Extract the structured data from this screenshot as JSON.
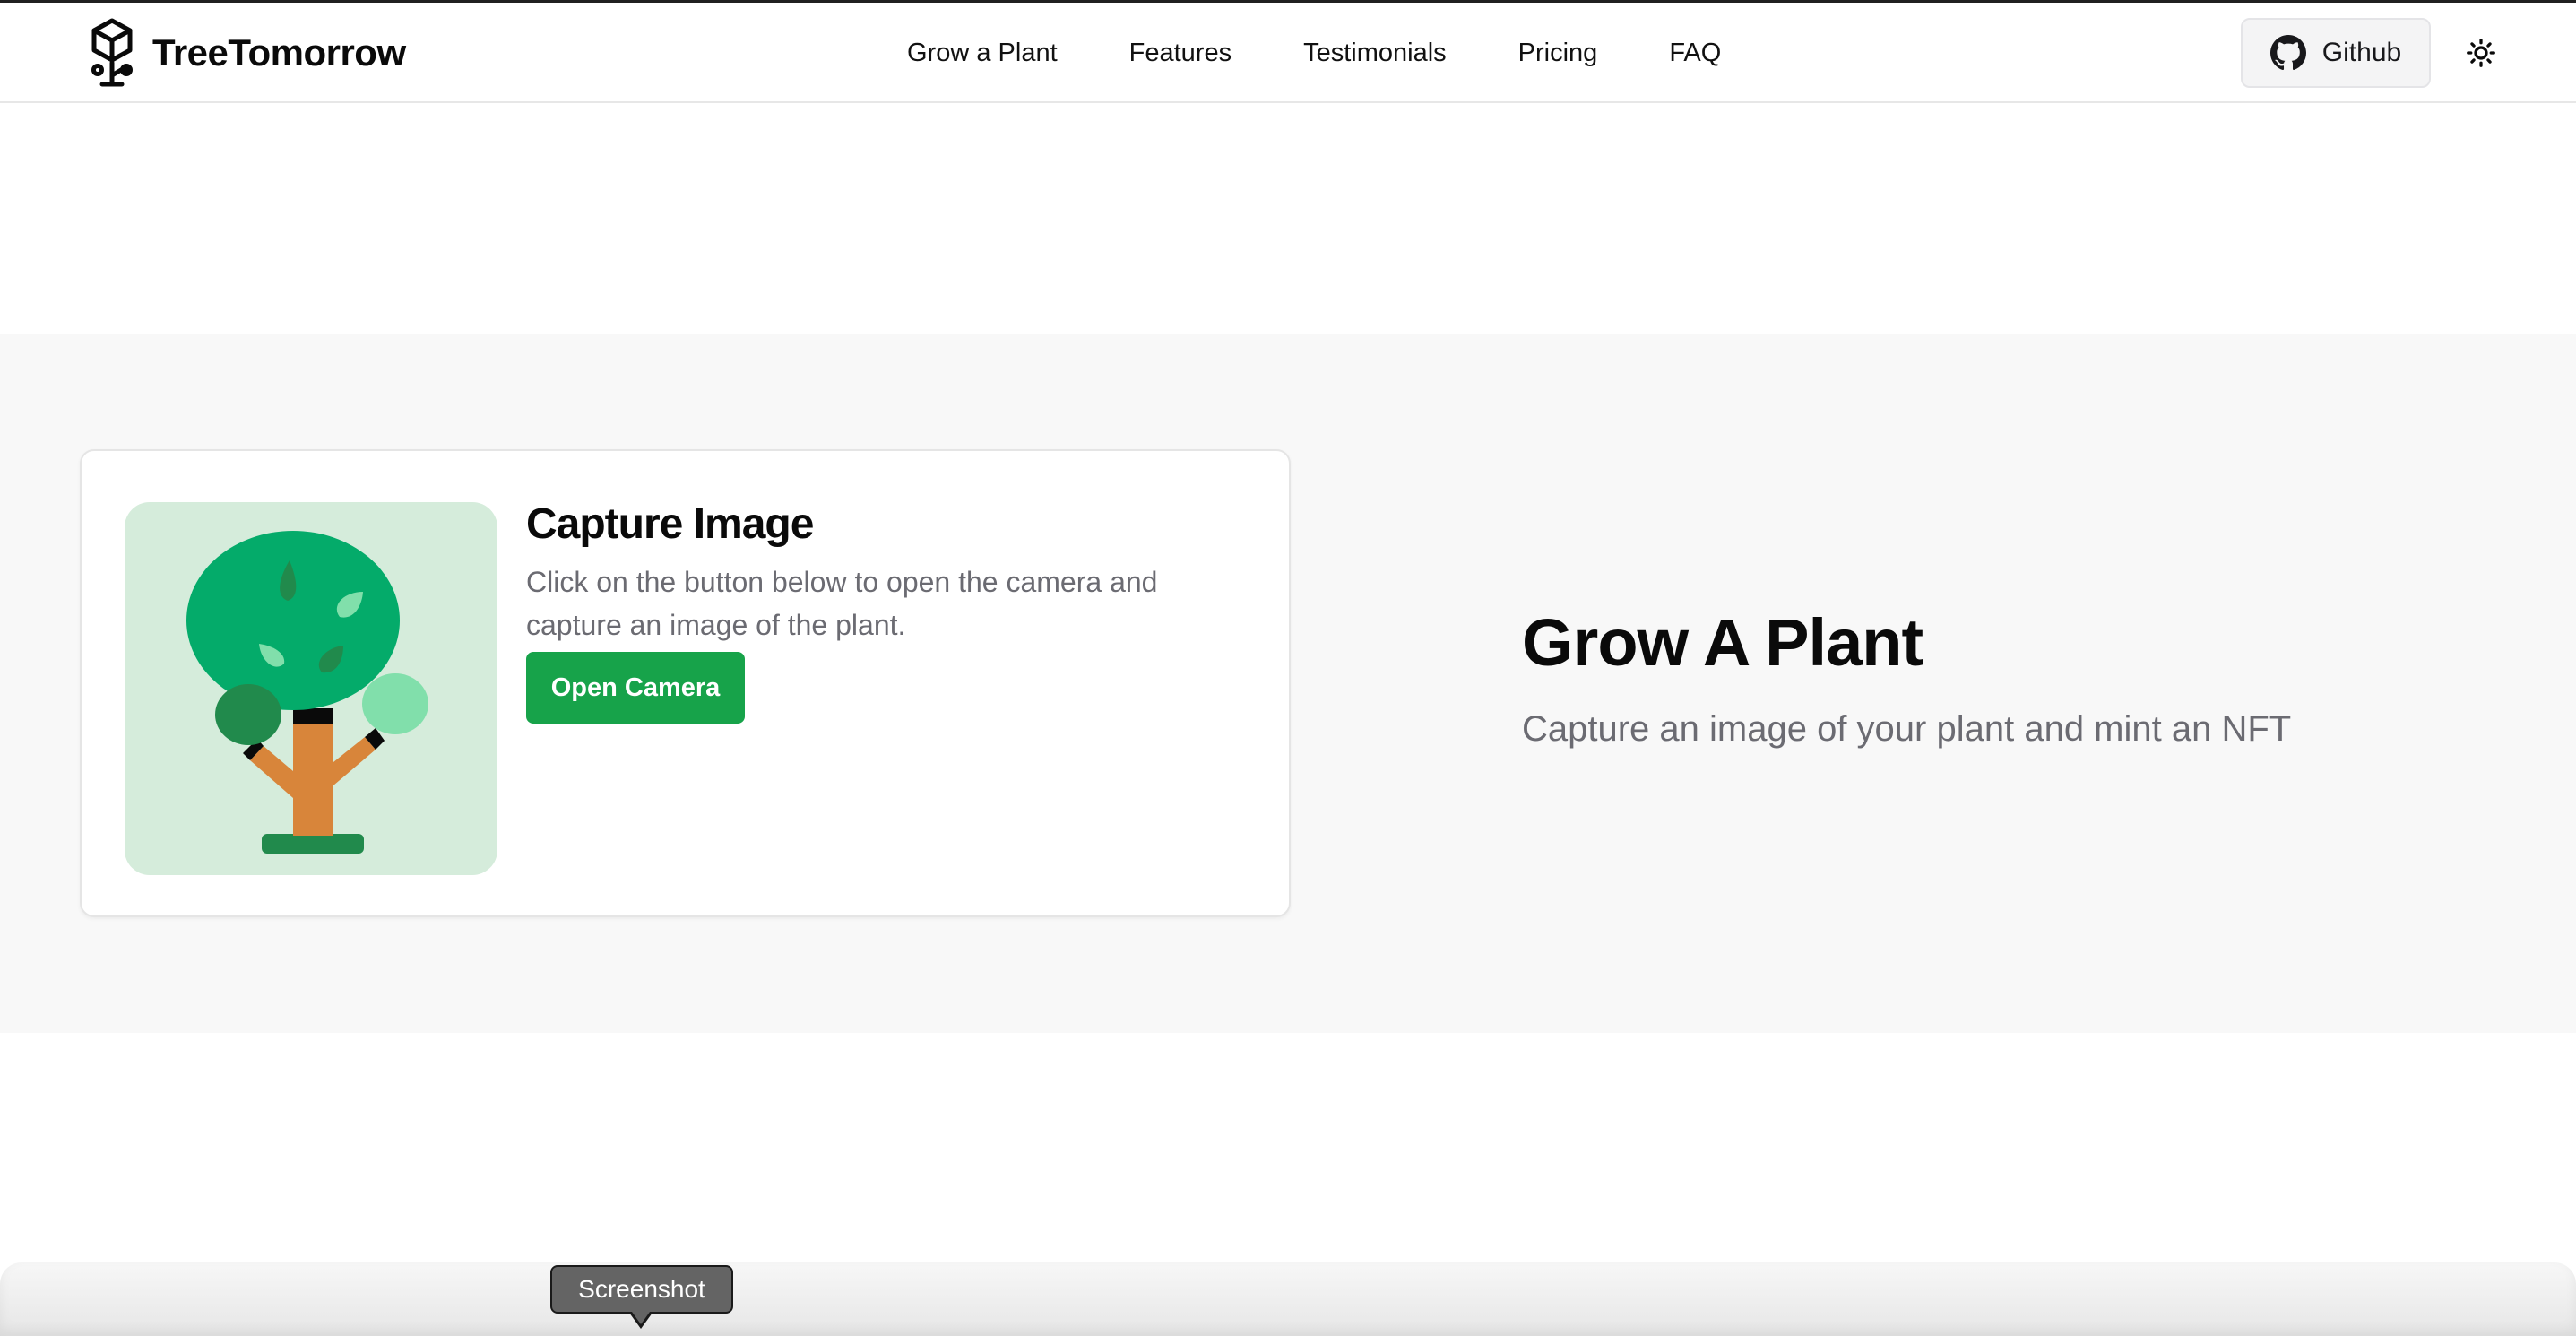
{
  "nav": {
    "brand": "TreeTomorrow",
    "brand_icon": "cube-tree-logo-icon",
    "links": [
      "Grow a Plant",
      "Features",
      "Testimonials",
      "Pricing",
      "FAQ"
    ],
    "github_label": "Github",
    "github_icon": "github-icon",
    "theme_icon": "sun-icon"
  },
  "card": {
    "image": "tree-illustration",
    "title": "Capture Image",
    "description": "Click on the button below to open the camera and capture an image of the plant.",
    "button_label": "Open Camera"
  },
  "hero": {
    "title": "Grow A Plant",
    "subtitle": "Capture an image of your plant and mint an NFT"
  },
  "dock": {
    "tooltip": "Screenshot"
  },
  "colors": {
    "accent": "#17a34a",
    "section_bg": "#f8f8f8",
    "plant_bg": "#d5ecdb",
    "muted_text": "#6b6b72"
  }
}
